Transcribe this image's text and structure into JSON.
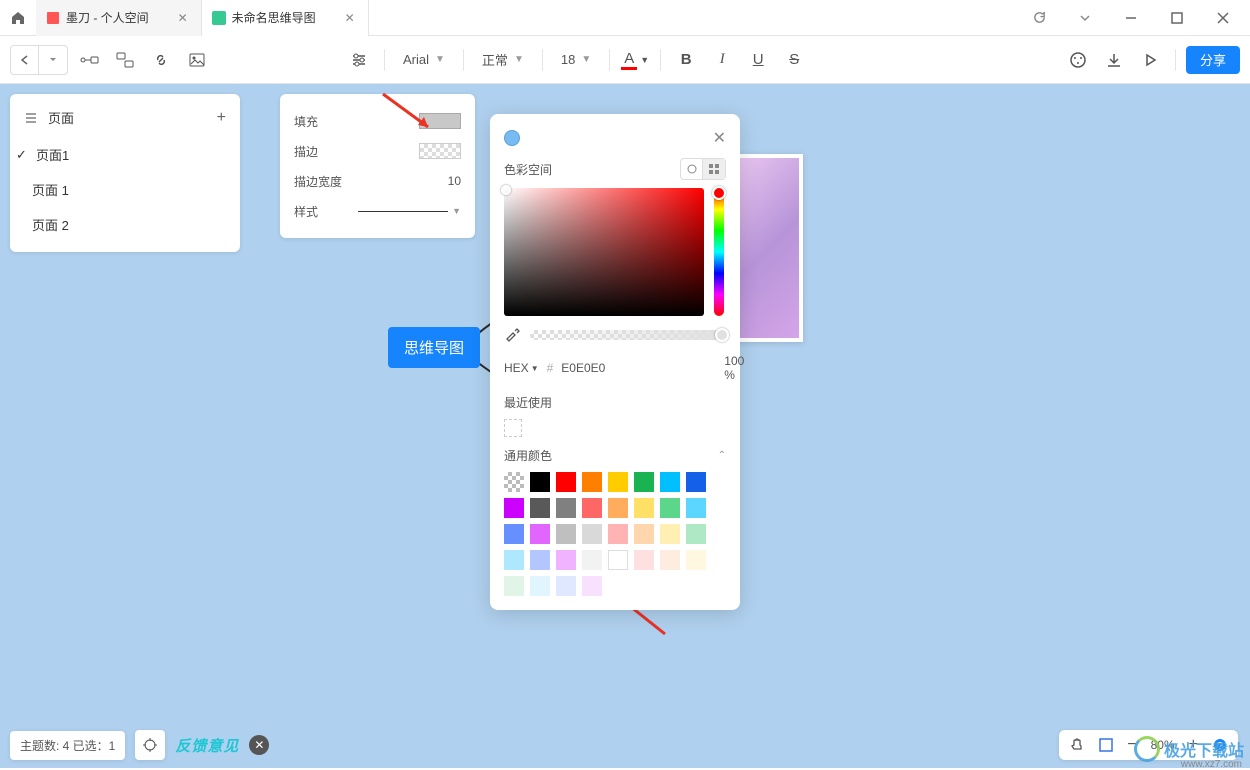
{
  "tabs": [
    {
      "icon_color": "#ff5555",
      "label": "墨刀 - 个人空间"
    },
    {
      "icon_color": "#35c994",
      "label": "未命名思维导图"
    }
  ],
  "toolbar": {
    "font": "Arial",
    "weight": "正常",
    "size": "18",
    "share": "分享"
  },
  "pages": {
    "title": "页面",
    "items": [
      "页面1",
      "页面 1",
      "页面 2"
    ]
  },
  "props": {
    "fill": "填充",
    "stroke": "描边",
    "stroke_width_label": "描边宽度",
    "stroke_width_value": "10",
    "style": "样式"
  },
  "node_text": "思维导图",
  "color_picker": {
    "space": "色彩空间",
    "hex_label": "HEX",
    "hex_value": "E0E0E0",
    "opacity": "100 %",
    "recent": "最近使用",
    "common": "通用颜色"
  },
  "swatches": [
    [
      "checker",
      "#000000",
      "#ff0000",
      "#ff8000",
      "#ffcc00",
      "#19b351",
      "#00bfff",
      "#1460e6",
      "#cc00ff"
    ],
    [
      "",
      "#595959",
      "#808080",
      "#ff6666",
      "#ffad5c",
      "#ffe066",
      "#5cd68a",
      "#5cd6ff",
      "#668fff",
      "#e066ff"
    ],
    [
      "",
      "#bfbfbf",
      "#d9d9d9",
      "#ffb3b3",
      "#ffd6ad",
      "#ffefb3",
      "#aee8c4",
      "#ade8ff",
      "#b3c6ff",
      "#efb3ff"
    ],
    [
      "",
      "#f2f2f2",
      "#ffffff",
      "#ffe0e0",
      "#ffece0",
      "#fff8e0",
      "#e0f5e8",
      "#e0f5ff",
      "#e0e8ff",
      "#f8e0ff"
    ]
  ],
  "status": {
    "text": "主题数: 4 已选：1",
    "feedback": "反馈意见"
  },
  "zoom": {
    "pct": "80%"
  },
  "watermark": {
    "text": "极光下载站",
    "sub": "www.xz7.com"
  }
}
